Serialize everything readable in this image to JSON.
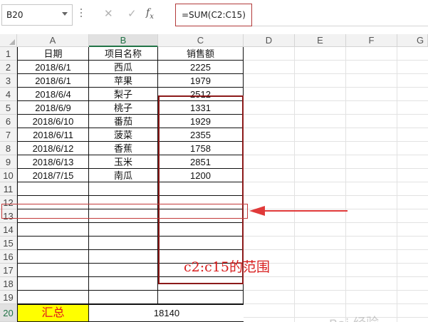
{
  "formula_bar": {
    "name_box": "B20",
    "cancel_icon": "close-icon",
    "enter_icon": "check-icon",
    "fx_label": "fx",
    "formula": "=SUM(C2:C15)"
  },
  "columns": [
    "A",
    "B",
    "C",
    "D",
    "E",
    "F",
    "G"
  ],
  "rows": [
    "1",
    "2",
    "3",
    "4",
    "5",
    "6",
    "7",
    "8",
    "9",
    "10",
    "11",
    "12",
    "13",
    "14",
    "15",
    "16",
    "17",
    "18",
    "19",
    "20"
  ],
  "header": {
    "date": "日期",
    "item": "项目名称",
    "sales": "销售额"
  },
  "data": [
    {
      "date": "2018/6/1",
      "item": "西瓜",
      "sales": "2225"
    },
    {
      "date": "2018/6/1",
      "item": "苹果",
      "sales": "1979"
    },
    {
      "date": "2018/6/4",
      "item": "梨子",
      "sales": "2512"
    },
    {
      "date": "2018/6/9",
      "item": "桃子",
      "sales": "1331"
    },
    {
      "date": "2018/6/10",
      "item": "番茄",
      "sales": "1929"
    },
    {
      "date": "2018/6/11",
      "item": "菠菜",
      "sales": "2355"
    },
    {
      "date": "2018/6/12",
      "item": "香蕉",
      "sales": "1758"
    },
    {
      "date": "2018/6/13",
      "item": "玉米",
      "sales": "2851"
    },
    {
      "date": "2018/7/15",
      "item": "南瓜",
      "sales": "1200"
    }
  ],
  "total": {
    "label": "汇总",
    "value": "18140"
  },
  "annotation": {
    "text": "c2:c15的范围",
    "color": "#d81f1f"
  },
  "watermark": {
    "text": "Bai 经验"
  },
  "colors": {
    "highlight": "#ffff00",
    "total_text": "#e0101a",
    "range_border": "#8c1a1a",
    "excel_green": "#217346"
  }
}
